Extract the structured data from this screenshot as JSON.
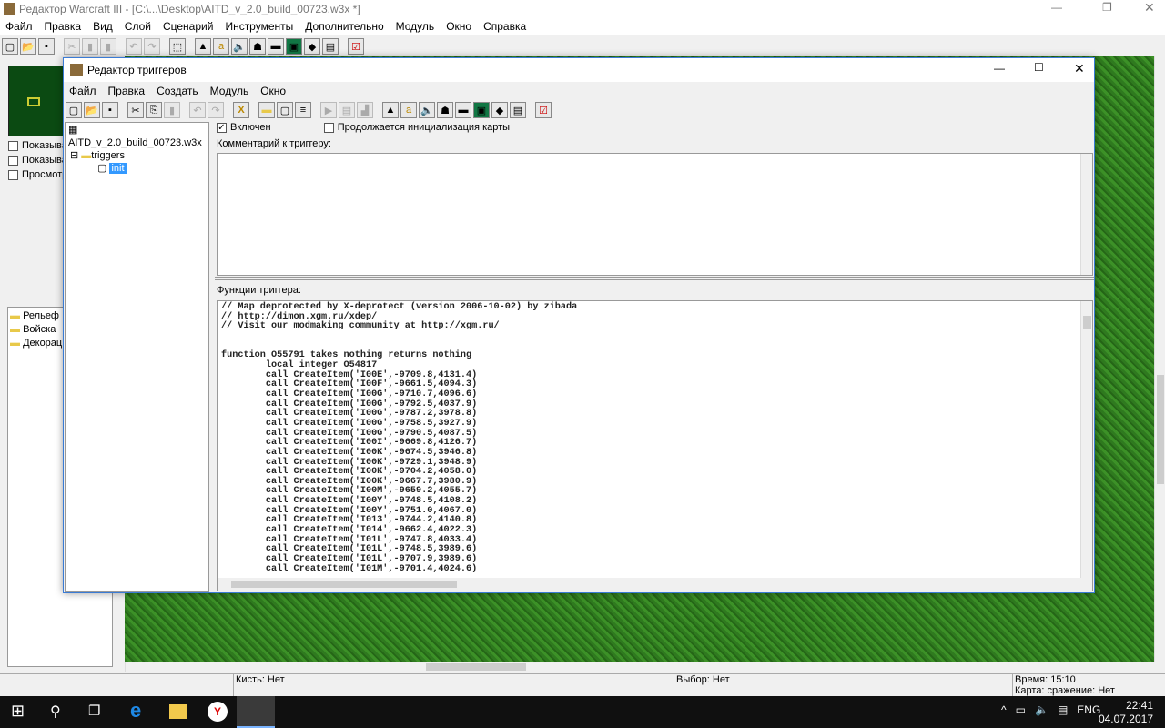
{
  "main_window": {
    "title": "Редактор Warcraft III  - [C:\\...\\Desktop\\AITD_v_2.0_build_00723.w3x *]",
    "menu": [
      "Файл",
      "Правка",
      "Вид",
      "Слой",
      "Сценарий",
      "Инструменты",
      "Дополнительно",
      "Модуль",
      "Окно",
      "Справка"
    ]
  },
  "left_panel": {
    "checkboxes": [
      "Показыва",
      "Показыва",
      "Просмотр"
    ],
    "palette": [
      "Рельеф",
      "Войска",
      "Декорац"
    ]
  },
  "trigger_editor": {
    "title": "Редактор триггеров",
    "menu": [
      "Файл",
      "Правка",
      "Создать",
      "Модуль",
      "Окно"
    ],
    "tree": {
      "root": "AITD_v_2.0_build_00723.w3x",
      "folder": "triggers",
      "item": "init"
    },
    "enabled_label": "Включен",
    "enabled": true,
    "init_label": "Продолжается инициализация карты",
    "init": false,
    "comment_label": "Комментарий к триггеру:",
    "comment": "",
    "functions_label": "Функции триггера:",
    "code": "// Map deprotected by X-deprotect (version 2006-10-02) by zibada\n// http://dimon.xgm.ru/xdep/\n// Visit our modmaking community at http://xgm.ru/\n\n\nfunction O55791 takes nothing returns nothing\n        local integer O54817\n        call CreateItem('I00E',-9709.8,4131.4)\n        call CreateItem('I00F',-9661.5,4094.3)\n        call CreateItem('I00G',-9710.7,4096.6)\n        call CreateItem('I00G',-9792.5,4037.9)\n        call CreateItem('I00G',-9787.2,3978.8)\n        call CreateItem('I00G',-9758.5,3927.9)\n        call CreateItem('I00G',-9790.5,4087.5)\n        call CreateItem('I00I',-9669.8,4126.7)\n        call CreateItem('I00K',-9674.5,3946.8)\n        call CreateItem('I00K',-9729.1,3948.9)\n        call CreateItem('I00K',-9704.2,4058.0)\n        call CreateItem('I00K',-9667.7,3980.9)\n        call CreateItem('I00M',-9659.2,4055.7)\n        call CreateItem('I00Y',-9748.5,4108.2)\n        call CreateItem('I00Y',-9751.0,4067.0)\n        call CreateItem('I013',-9744.2,4140.8)\n        call CreateItem('I014',-9662.4,4022.3)\n        call CreateItem('I01L',-9747.8,4033.4)\n        call CreateItem('I01L',-9748.5,3989.6)\n        call CreateItem('I01L',-9707.9,3989.6)\n        call CreateItem('I01M',-9701.4,4024.6)"
  },
  "status": {
    "brush": "Кисть: Нет",
    "selection": "Выбор: Нет",
    "time": "Время: 15:10",
    "map": "Карта: сражение: Нет"
  },
  "taskbar": {
    "lang": "ENG",
    "time": "22:41",
    "date": "04.07.2017"
  }
}
